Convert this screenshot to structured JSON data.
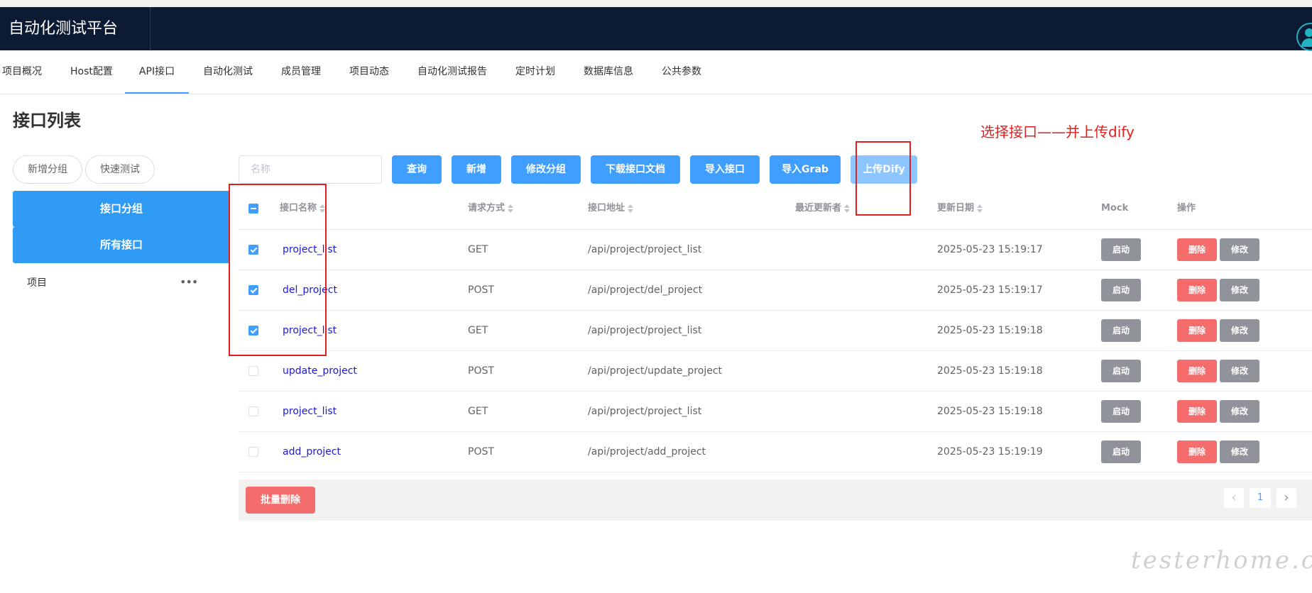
{
  "app": {
    "title": "自动化测试平台"
  },
  "nav": {
    "items": [
      {
        "label": "项目概况"
      },
      {
        "label": "Host配置"
      },
      {
        "label": "API接口",
        "active": true
      },
      {
        "label": "自动化测试"
      },
      {
        "label": "成员管理"
      },
      {
        "label": "项目动态"
      },
      {
        "label": "自动化测试报告"
      },
      {
        "label": "定时计划"
      },
      {
        "label": "数据库信息"
      },
      {
        "label": "公共参数"
      }
    ]
  },
  "page": {
    "title": "接口列表"
  },
  "left_panel": {
    "add_group_label": "新增分组",
    "quick_test_label": "快速测试",
    "group_header_label": "接口分组",
    "all_interfaces_label": "所有接口",
    "tree_item_label": "项目",
    "tree_more_label": "•••"
  },
  "toolbar": {
    "search_placeholder": "名称",
    "query_label": "查询",
    "add_label": "新增",
    "edit_group_label": "修改分组",
    "download_doc_label": "下载接口文档",
    "import_label": "导入接口",
    "import_grab_label": "导入Grab",
    "upload_dify_label": "上传Dify"
  },
  "table": {
    "columns": {
      "name": "接口名称",
      "method": "请求方式",
      "path": "接口地址",
      "updater": "最近更新者",
      "date": "更新日期",
      "mock": "Mock",
      "ops": "操作"
    },
    "rows": [
      {
        "checked": true,
        "name": "project_list",
        "method": "GET",
        "path": "/api/project/project_list",
        "updater": "",
        "date": "2025-05-23 15:19:17",
        "mock": "启动",
        "delete": "删除",
        "edit": "修改"
      },
      {
        "checked": true,
        "name": "del_project",
        "method": "POST",
        "path": "/api/project/del_project",
        "updater": "",
        "date": "2025-05-23 15:19:17",
        "mock": "启动",
        "delete": "删除",
        "edit": "修改"
      },
      {
        "checked": true,
        "name": "project_list",
        "method": "GET",
        "path": "/api/project/project_list",
        "updater": "",
        "date": "2025-05-23 15:19:18",
        "mock": "启动",
        "delete": "删除",
        "edit": "修改"
      },
      {
        "checked": false,
        "name": "update_project",
        "method": "POST",
        "path": "/api/project/update_project",
        "updater": "",
        "date": "2025-05-23 15:19:18",
        "mock": "启动",
        "delete": "删除",
        "edit": "修改"
      },
      {
        "checked": false,
        "name": "project_list",
        "method": "GET",
        "path": "/api/project/project_list",
        "updater": "",
        "date": "2025-05-23 15:19:18",
        "mock": "启动",
        "delete": "删除",
        "edit": "修改"
      },
      {
        "checked": false,
        "name": "add_project",
        "method": "POST",
        "path": "/api/project/add_project",
        "updater": "",
        "date": "2025-05-23 15:19:19",
        "mock": "启动",
        "delete": "删除",
        "edit": "修改"
      }
    ]
  },
  "footer": {
    "batch_delete_label": "批量删除",
    "pagination": {
      "prev": "‹",
      "current_page": "1",
      "next": "›"
    }
  },
  "annotation": {
    "text": "选择接口——并上传dify",
    "color": "#e02020"
  },
  "watermark": {
    "text": "testerhome.com"
  },
  "colors": {
    "header_bg": "#0c1a33",
    "primary": "#409eff",
    "group_block": "#2f9bf5",
    "danger": "#f56c6c",
    "neutral": "#909399",
    "link": "#1a1ad6"
  }
}
